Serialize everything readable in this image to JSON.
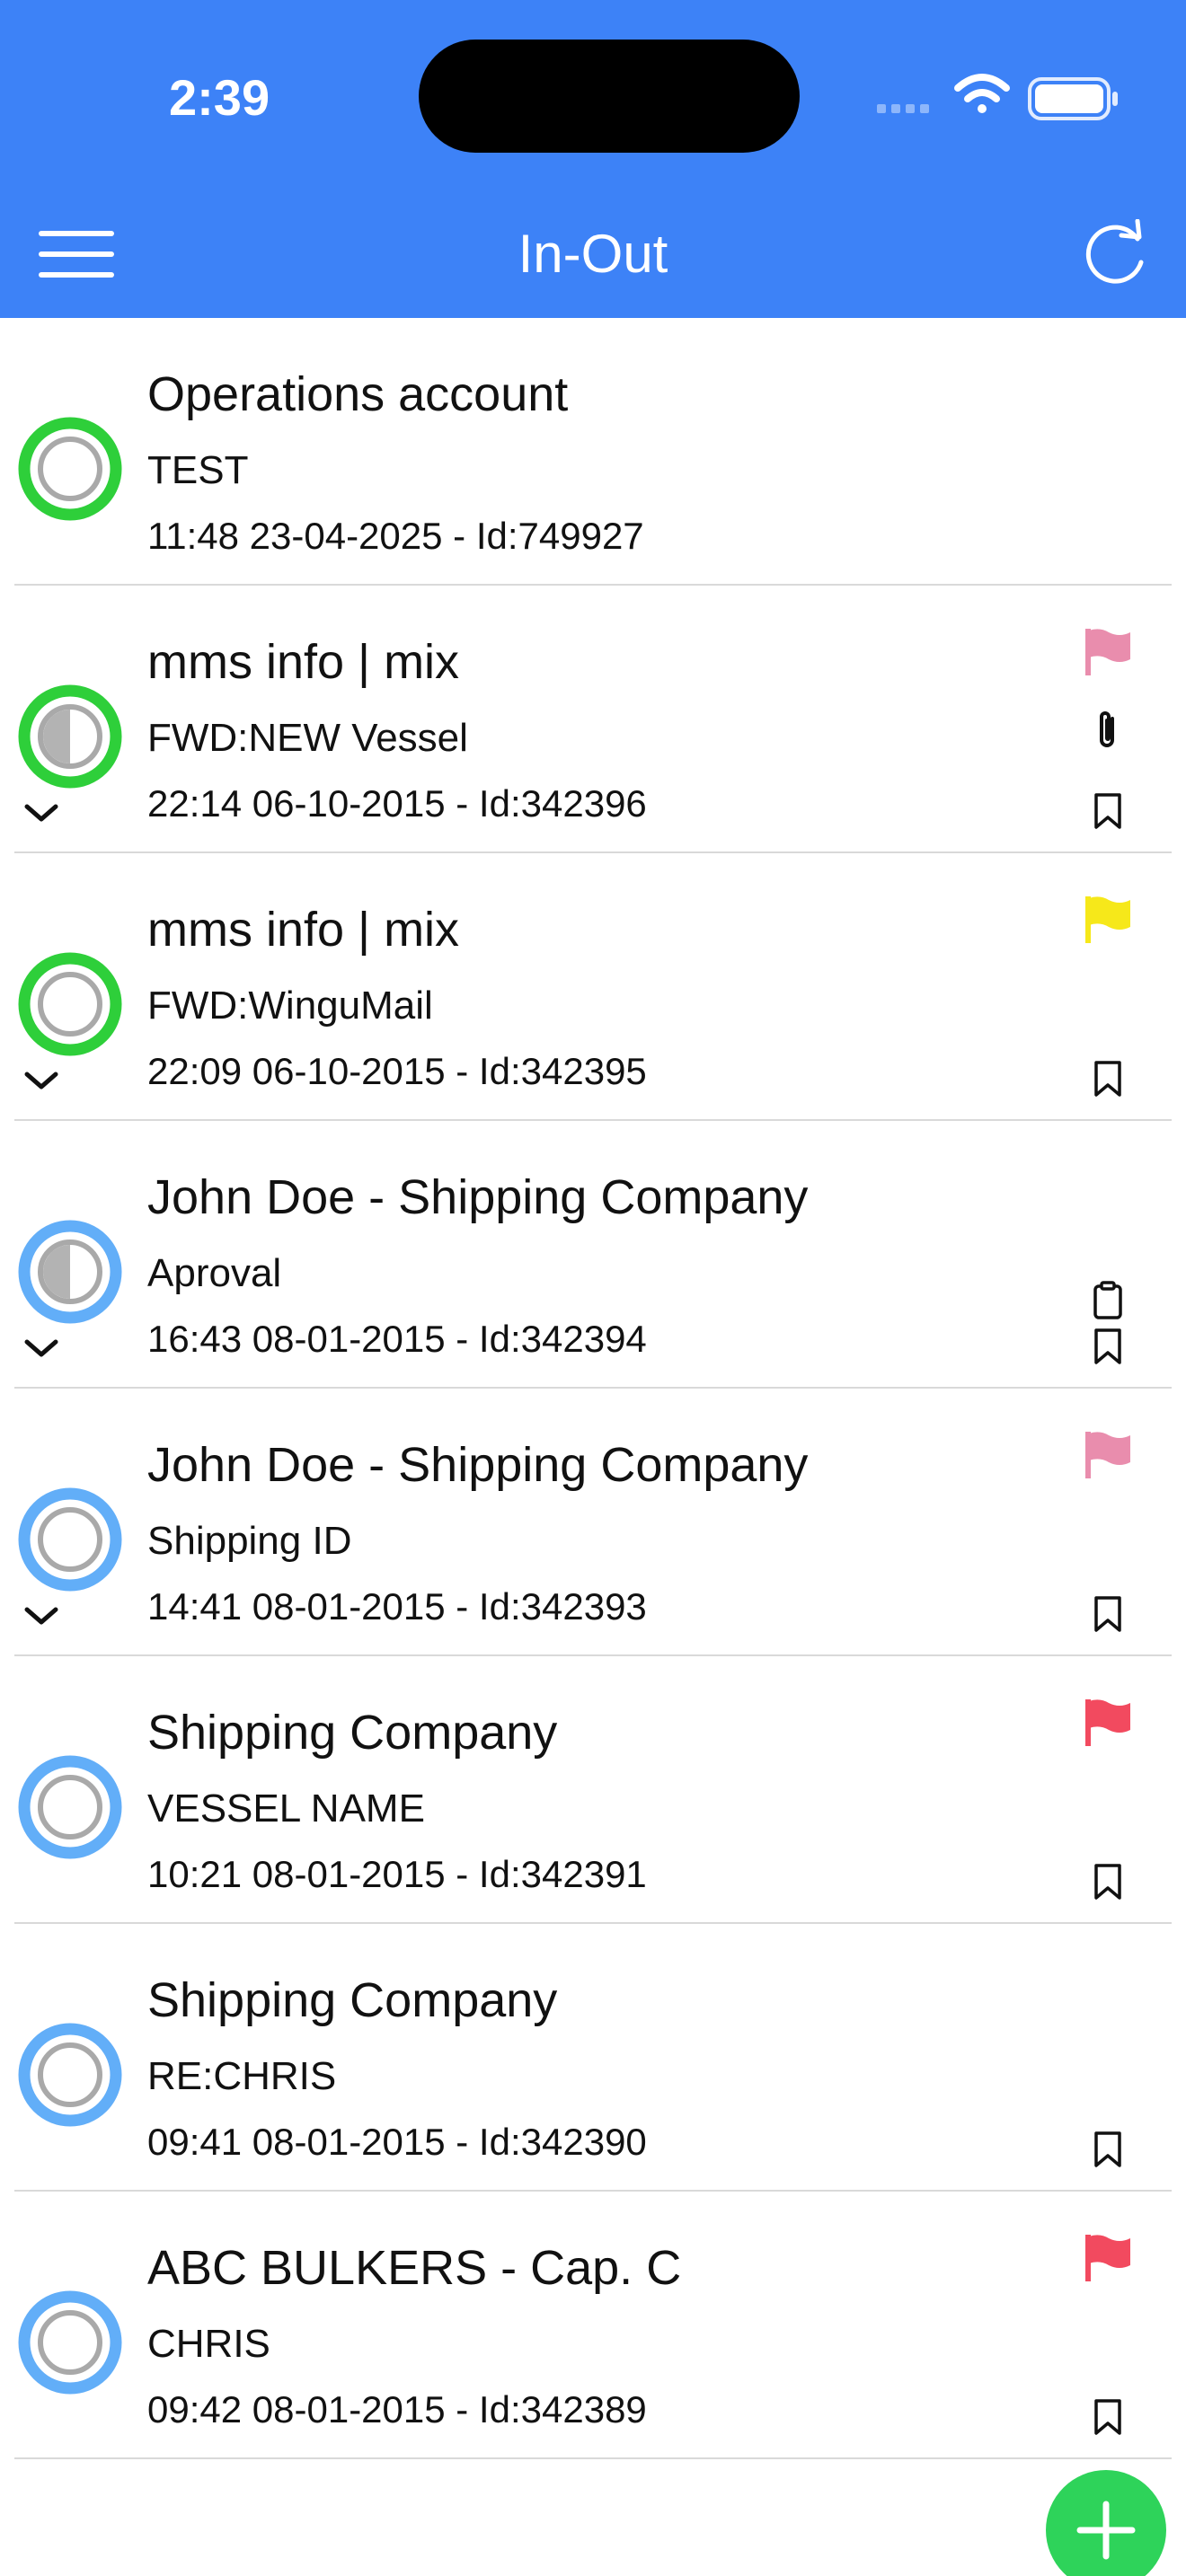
{
  "status_bar": {
    "time": "2:39"
  },
  "header": {
    "title": "In-Out"
  },
  "colors": {
    "header_bg": "#3d82f7",
    "ring_green": "#2ecf3a",
    "ring_blue": "#62aef8",
    "flag_pink": "#e98dad",
    "flag_yellow": "#f6e81a",
    "flag_red": "#f24a5f",
    "fab_green": "#2ed35a"
  },
  "items": [
    {
      "title": "Operations account",
      "subject": "TEST",
      "meta": "11:48 23-04-2025 - Id:749927",
      "ring": "green",
      "state": "empty",
      "expandable": false,
      "flag": null,
      "attachment": false,
      "clipboard": false,
      "bookmark": false
    },
    {
      "title": "mms info | mix",
      "subject": "FWD:NEW Vessel",
      "meta": "22:14 06-10-2015 - Id:342396",
      "ring": "green",
      "state": "half",
      "expandable": true,
      "flag": "pink",
      "attachment": true,
      "clipboard": false,
      "bookmark": true
    },
    {
      "title": "mms info | mix",
      "subject": "FWD:WinguMail",
      "meta": "22:09 06-10-2015 - Id:342395",
      "ring": "green",
      "state": "empty",
      "expandable": true,
      "flag": "yellow",
      "attachment": false,
      "clipboard": false,
      "bookmark": true
    },
    {
      "title": "John Doe - Shipping Company",
      "subject": "Aproval",
      "meta": "16:43 08-01-2015 - Id:342394",
      "ring": "blue",
      "state": "half",
      "expandable": true,
      "flag": null,
      "attachment": false,
      "clipboard": true,
      "bookmark": true
    },
    {
      "title": "John Doe - Shipping Company",
      "subject": "Shipping ID",
      "meta": "14:41 08-01-2015 - Id:342393",
      "ring": "blue",
      "state": "empty",
      "expandable": true,
      "flag": "pink",
      "attachment": false,
      "clipboard": false,
      "bookmark": true
    },
    {
      "title": "Shipping Company",
      "subject": "VESSEL NAME",
      "meta": "10:21 08-01-2015 - Id:342391",
      "ring": "blue",
      "state": "empty",
      "expandable": false,
      "flag": "red",
      "attachment": false,
      "clipboard": false,
      "bookmark": true
    },
    {
      "title": "Shipping Company",
      "subject": "RE:CHRIS",
      "meta": "09:41 08-01-2015 - Id:342390",
      "ring": "blue",
      "state": "empty",
      "expandable": false,
      "flag": null,
      "attachment": false,
      "clipboard": false,
      "bookmark": true
    },
    {
      "title": "ABC BULKERS - Cap. C",
      "subject": "CHRIS",
      "meta": "09:42 08-01-2015 - Id:342389",
      "ring": "blue",
      "state": "empty",
      "expandable": false,
      "flag": "red",
      "attachment": false,
      "clipboard": false,
      "bookmark": true
    }
  ],
  "icons": {
    "menu": "hamburger-icon",
    "refresh": "refresh-icon",
    "compose": "plus-icon",
    "flag": "flag-icon",
    "attachment": "paperclip-icon",
    "clipboard": "clipboard-icon",
    "bookmark": "bookmark-icon",
    "expand": "chevron-down-icon"
  }
}
